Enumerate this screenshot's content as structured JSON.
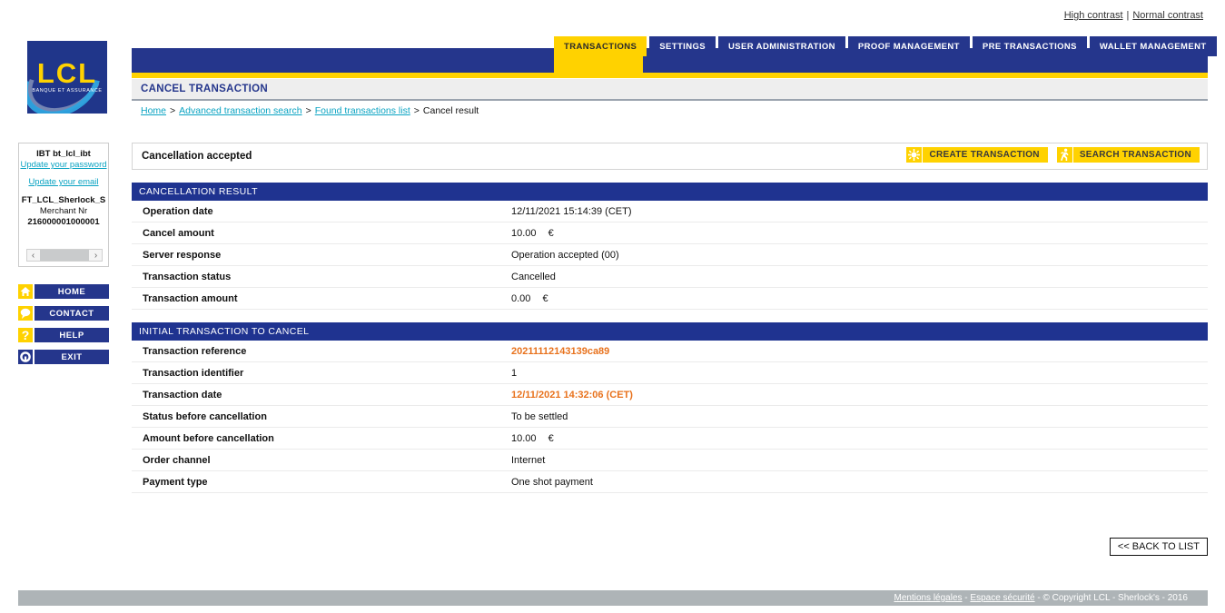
{
  "topbar": {
    "high_contrast": "High contrast",
    "separator": "|",
    "normal_contrast": "Normal contrast"
  },
  "logo": {
    "name": "LCL",
    "tagline": "BANQUE ET ASSURANCE"
  },
  "tabs": [
    {
      "label": "TRANSACTIONS",
      "active": true
    },
    {
      "label": "SETTINGS",
      "active": false
    },
    {
      "label": "USER ADMINISTRATION",
      "active": false
    },
    {
      "label": "PROOF MANAGEMENT",
      "active": false
    },
    {
      "label": "PRE TRANSACTIONS",
      "active": false
    },
    {
      "label": "WALLET MANAGEMENT",
      "active": false
    }
  ],
  "page": {
    "title": "CANCEL TRANSACTION"
  },
  "breadcrumb": [
    {
      "label": "Home",
      "link": true
    },
    {
      "label": "Advanced transaction search",
      "link": true
    },
    {
      "label": "Found transactions list",
      "link": true
    },
    {
      "label": "Cancel result",
      "link": false
    }
  ],
  "breadcrumb_separator": ">",
  "sidebar": {
    "user": {
      "account": "IBT bt_lcl_ibt",
      "update_password": "Update your password",
      "update_email": "Update your email",
      "merchant_name": "FT_LCL_Sherlock_S",
      "merchant_nr_label": "Merchant Nr",
      "merchant_nr": "216000001000001",
      "scroll_left": "‹",
      "scroll_right": "›"
    },
    "nav": [
      {
        "label": "HOME",
        "icon": "home-icon"
      },
      {
        "label": "CONTACT",
        "icon": "speech-bubble-icon"
      },
      {
        "label": "HELP",
        "icon": "question-mark-icon"
      },
      {
        "label": "EXIT",
        "icon": "power-exit-icon"
      }
    ]
  },
  "message": "Cancellation accepted",
  "actions": [
    {
      "label": "CREATE TRANSACTION",
      "icon": "starburst-icon"
    },
    {
      "label": "SEARCH TRANSACTION",
      "icon": "running-person-icon"
    }
  ],
  "sections": [
    {
      "title": "CANCELLATION RESULT",
      "rows": [
        {
          "key": "Operation date",
          "value": "12/11/2021 15:14:39 (CET)",
          "currency": "",
          "highlight": false
        },
        {
          "key": "Cancel amount",
          "value": "10.00",
          "currency": "€",
          "highlight": false
        },
        {
          "key": "Server response",
          "value": "Operation accepted (00)",
          "currency": "",
          "highlight": false
        },
        {
          "key": "Transaction status",
          "value": "Cancelled",
          "currency": "",
          "highlight": false
        },
        {
          "key": "Transaction amount",
          "value": "0.00",
          "currency": "€",
          "highlight": false
        }
      ]
    },
    {
      "title": "INITIAL TRANSACTION TO CANCEL",
      "rows": [
        {
          "key": "Transaction reference",
          "value": "20211112143139ca89",
          "currency": "",
          "highlight": true
        },
        {
          "key": "Transaction identifier",
          "value": "1",
          "currency": "",
          "highlight": false
        },
        {
          "key": "Transaction date",
          "value": "12/11/2021 14:32:06 (CET)",
          "currency": "",
          "highlight": true
        },
        {
          "key": "Status before cancellation",
          "value": "To be settled",
          "currency": "",
          "highlight": false
        },
        {
          "key": "Amount before cancellation",
          "value": "10.00",
          "currency": "€",
          "highlight": false
        },
        {
          "key": "Order channel",
          "value": "Internet",
          "currency": "",
          "highlight": false
        },
        {
          "key": "Payment type",
          "value": "One shot payment",
          "currency": "",
          "highlight": false
        }
      ]
    }
  ],
  "back_button": "<< BACK TO LIST",
  "footer": {
    "legal": "Mentions légales",
    "sep1": " - ",
    "security": "Espace sécurité",
    "copyright": " - © Copyright LCL - Sherlock's - 2016"
  },
  "colors": {
    "brand_blue": "#25368c",
    "brand_yellow": "#ffd200",
    "section_blue": "#1f3390",
    "link_cyan": "#0aa3c2",
    "highlight_orange": "#e8721d",
    "footer_gray": "#aeb4b7"
  }
}
